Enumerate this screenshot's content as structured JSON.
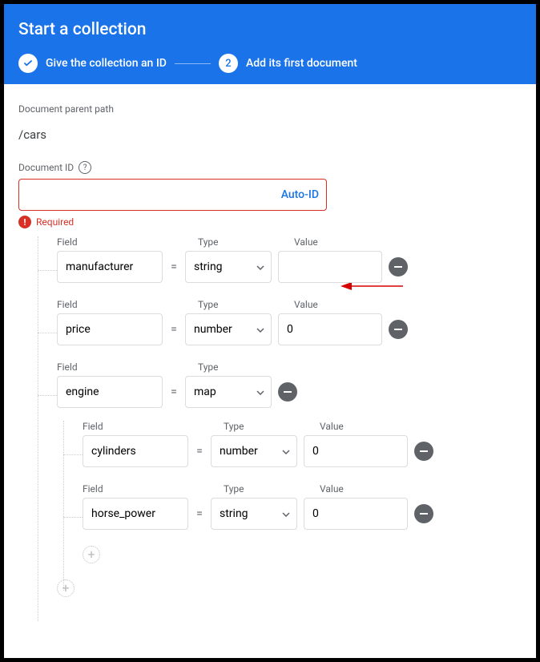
{
  "header": {
    "title": "Start a collection",
    "step1": "Give the collection an ID",
    "step2_num": "2",
    "step2": "Add its first document"
  },
  "parent_path": {
    "label": "Document parent path",
    "value": "/cars"
  },
  "doc_id": {
    "label": "Document ID",
    "value": "",
    "auto_label": "Auto-ID",
    "required": "Required"
  },
  "labels": {
    "field": "Field",
    "type": "Type",
    "value": "Value",
    "eq": "="
  },
  "fields": [
    {
      "name": "manufacturer",
      "type": "string",
      "value": ""
    },
    {
      "name": "price",
      "type": "number",
      "value": "0"
    },
    {
      "name": "engine",
      "type": "map",
      "children": [
        {
          "name": "cylinders",
          "type": "number",
          "value": "0"
        },
        {
          "name": "horse_power",
          "type": "string",
          "value": "0"
        }
      ]
    }
  ],
  "col_widths": {
    "field": 132,
    "type": 108,
    "value": 130,
    "nested_field": 132,
    "nested_type": 108,
    "nested_value": 130
  }
}
